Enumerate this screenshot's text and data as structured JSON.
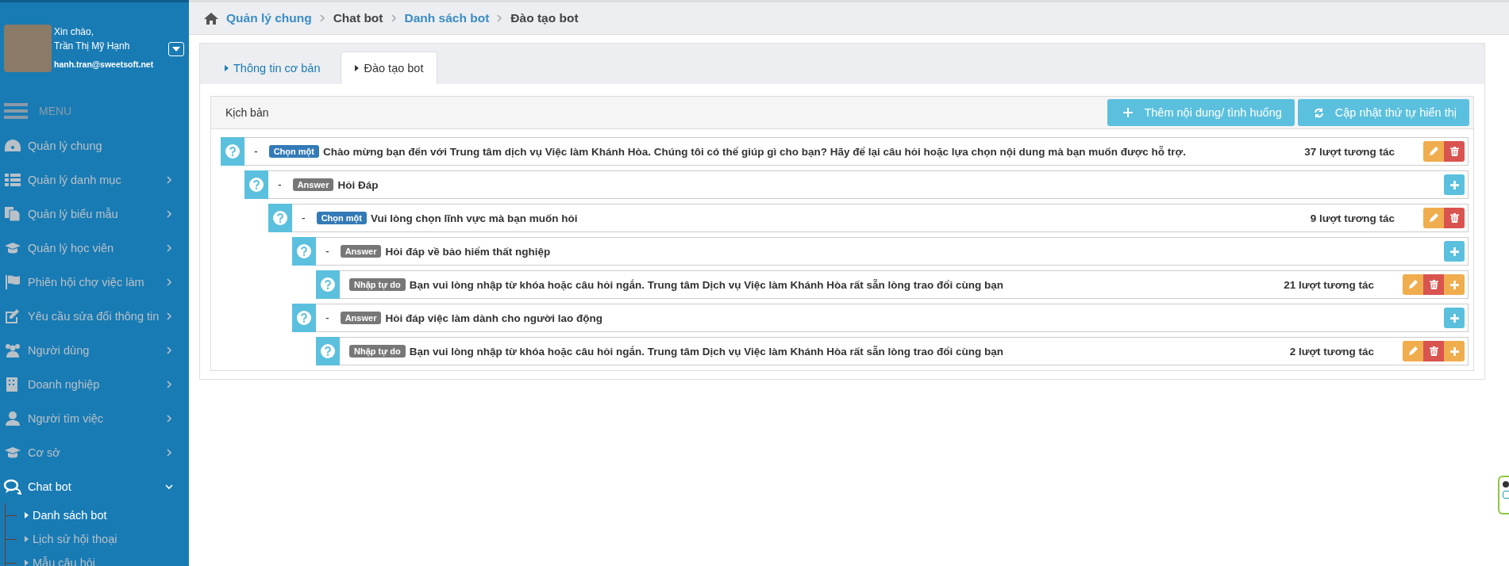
{
  "user": {
    "greeting": "Xin chào,",
    "name": "Trần Thị Mỹ Hạnh",
    "email": "hanh.tran@sweetsoft.net"
  },
  "menu_title": "MENU",
  "sidebar": {
    "items": [
      {
        "label": "Quản lý chung",
        "selected": false
      },
      {
        "label": "Quản lý danh mục",
        "expanded": false,
        "selected": false
      },
      {
        "label": "Quản lý biểu mẫu",
        "expanded": false,
        "selected": false
      },
      {
        "label": "Quản lý học viên",
        "expanded": false,
        "selected": false
      },
      {
        "label": "Phiên hội chợ việc làm",
        "expanded": false,
        "selected": false
      },
      {
        "label": "Yêu cầu sửa đổi thông tin",
        "expanded": false,
        "selected": false
      },
      {
        "label": "Người dùng",
        "expanded": false,
        "selected": false
      },
      {
        "label": "Doanh nghiệp",
        "expanded": false,
        "selected": false
      },
      {
        "label": "Người tìm việc",
        "expanded": false,
        "selected": false
      },
      {
        "label": "Cơ sở",
        "expanded": false,
        "selected": false
      },
      {
        "label": "Chat bot",
        "expanded": true,
        "selected": true,
        "children": [
          {
            "label": "Danh sách bot",
            "selected": true
          },
          {
            "label": "Lịch sử hội thoại",
            "selected": false
          },
          {
            "label": "Mẫu câu hỏi",
            "selected": false
          }
        ]
      }
    ]
  },
  "breadcrumb": [
    {
      "label": "Quản lý chung",
      "link": true
    },
    {
      "label": "Chat bot",
      "link": false
    },
    {
      "label": "Danh sách bot",
      "link": true
    },
    {
      "label": "Đào tạo bot",
      "link": false
    }
  ],
  "tabs": [
    {
      "label": "Thông tin cơ bản",
      "selected": false
    },
    {
      "label": "Đào tạo bot",
      "selected": true
    }
  ],
  "panel": {
    "title": "Kịch bản",
    "buttons": [
      {
        "label": "Thêm nội dung/ tình huống"
      },
      {
        "label": "Cập nhật thứ tự hiển thị"
      }
    ]
  },
  "tree": [
    {
      "toggle": "-",
      "badge": {
        "kind": "choice",
        "label": "Chọn một"
      },
      "text": "Chào mừng bạn đến với Trung tâm dịch vụ Việc làm Khánh Hòa. Chúng tôi có thể giúp gì cho bạn? Hãy để lại câu hỏi hoặc lựa chọn nội dung mà bạn muốn được hỗ trợ.",
      "count": "37 lượt tương tác",
      "actions": [
        {
          "kind": "edit"
        },
        {
          "kind": "delete"
        }
      ],
      "children": [
        {
          "toggle": "-",
          "badge": {
            "kind": "answer",
            "label": "Answer"
          },
          "text": "Hỏi Đáp",
          "actions": [
            {
              "kind": "add"
            }
          ],
          "children": [
            {
              "toggle": "-",
              "badge": {
                "kind": "choice",
                "label": "Chọn một"
              },
              "text": "Vui lòng chọn lĩnh vực mà bạn muốn hỏi",
              "count": "9 lượt tương tác",
              "actions": [
                {
                  "kind": "edit"
                },
                {
                  "kind": "delete"
                }
              ],
              "children": [
                {
                  "toggle": "-",
                  "badge": {
                    "kind": "answer",
                    "label": "Answer"
                  },
                  "text": "Hỏi đáp về bảo hiểm thất nghiệp",
                  "actions": [
                    {
                      "kind": "add"
                    }
                  ],
                  "children": [
                    {
                      "badge": {
                        "kind": "free",
                        "label": "Nhập tự do"
                      },
                      "text": "Bạn vui lòng nhập từ khóa hoặc câu hỏi ngắn. Trung tâm Dịch vụ Việc làm Khánh Hòa rất sẵn lòng trao đổi cùng bạn",
                      "count": "21 lượt tương tác",
                      "actions": [
                        {
                          "kind": "edit"
                        },
                        {
                          "kind": "delete"
                        },
                        {
                          "kind": "add"
                        }
                      ]
                    }
                  ]
                },
                {
                  "toggle": "-",
                  "badge": {
                    "kind": "answer",
                    "label": "Answer"
                  },
                  "text": "Hỏi đáp việc làm dành cho người lao động",
                  "actions": [
                    {
                      "kind": "add"
                    }
                  ],
                  "children": [
                    {
                      "badge": {
                        "kind": "free",
                        "label": "Nhập tự do"
                      },
                      "text": "Bạn vui lòng nhập từ khóa hoặc câu hỏi ngắn. Trung tâm Dịch vụ Việc làm Khánh Hòa rất sẵn lòng trao đổi cùng bạn",
                      "count": "2 lượt tương tác",
                      "actions": [
                        {
                          "kind": "edit"
                        },
                        {
                          "kind": "delete"
                        },
                        {
                          "kind": "add"
                        }
                      ]
                    }
                  ]
                }
              ]
            }
          ]
        }
      ]
    }
  ]
}
